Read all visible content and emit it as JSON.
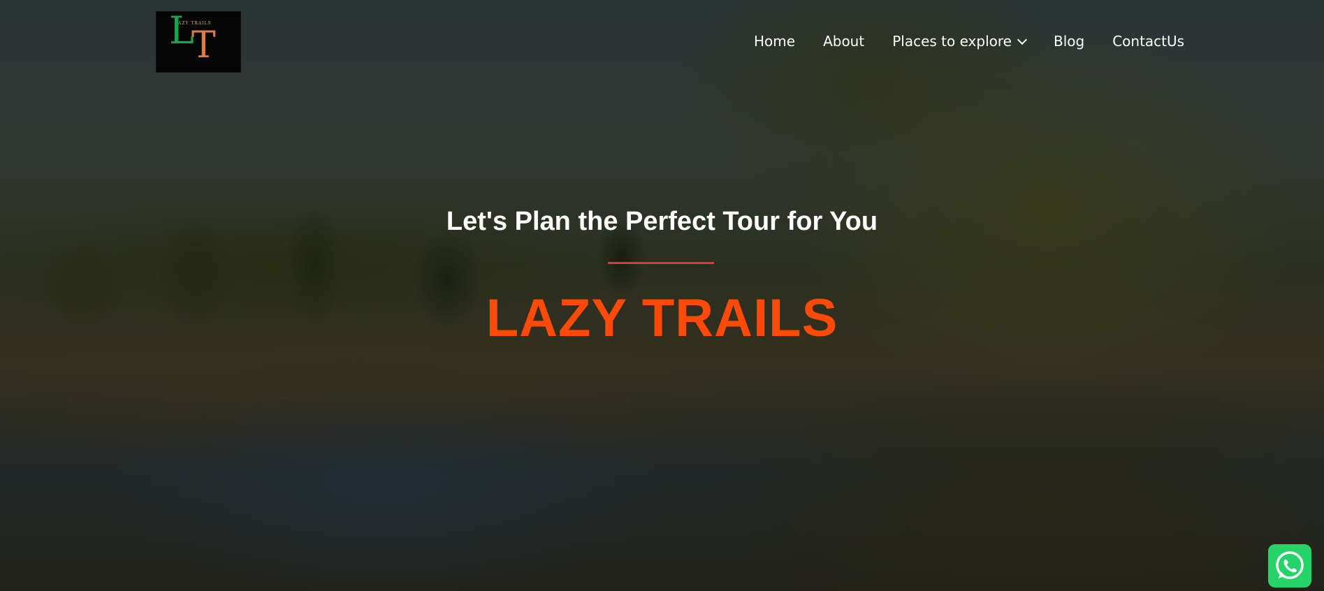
{
  "logo": {
    "small_text": "LAZY TRAILS",
    "letter_l": "L",
    "letter_t": "T"
  },
  "nav": {
    "home": "Home",
    "about": "About",
    "places": "Places to explore",
    "blog": "Blog",
    "contact": "ContactUs"
  },
  "hero": {
    "tagline": "Let's Plan the Perfect Tour for You",
    "brand": "LAZY TRAILS"
  },
  "colors": {
    "brand": "#ff4a0a",
    "divider": "#e8304a",
    "whatsapp": "#25d366"
  },
  "icons": {
    "dropdown": "chevron-down-icon",
    "whatsapp": "whatsapp-icon"
  }
}
